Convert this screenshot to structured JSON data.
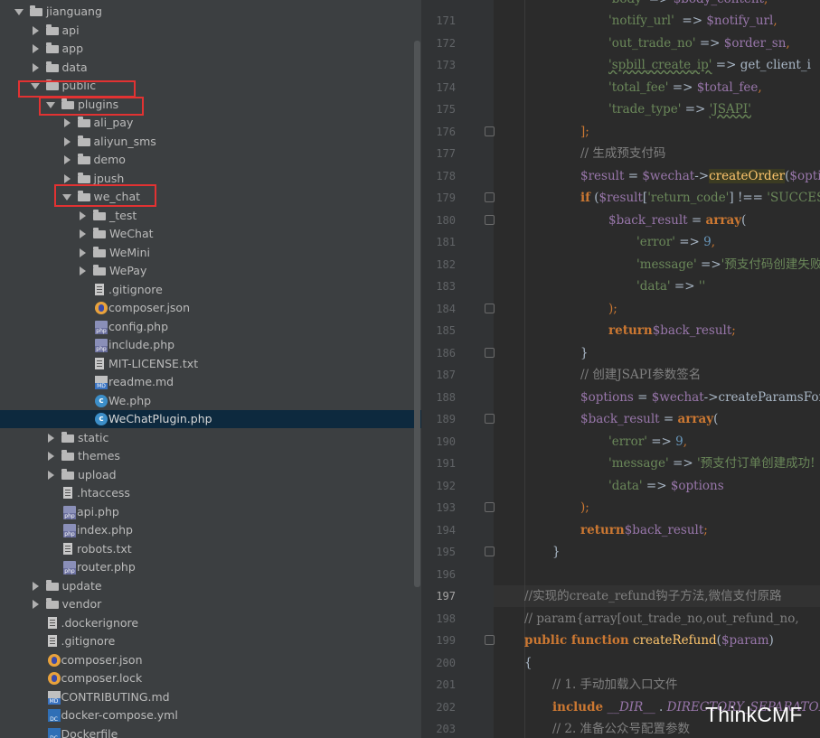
{
  "tree": {
    "rows": [
      {
        "label": "jianguang",
        "type": "folder",
        "expanded": true
      },
      {
        "label": "api",
        "type": "folder",
        "expanded": false
      },
      {
        "label": "app",
        "type": "folder",
        "expanded": false
      },
      {
        "label": "data",
        "type": "folder",
        "expanded": false
      },
      {
        "label": "public",
        "type": "folder",
        "expanded": true
      },
      {
        "label": "plugins",
        "type": "folder",
        "expanded": true
      },
      {
        "label": "ali_pay",
        "type": "folder",
        "expanded": false
      },
      {
        "label": "aliyun_sms",
        "type": "folder",
        "expanded": false
      },
      {
        "label": "demo",
        "type": "folder",
        "expanded": false
      },
      {
        "label": "jpush",
        "type": "folder",
        "expanded": false
      },
      {
        "label": "we_chat",
        "type": "folder",
        "expanded": true
      },
      {
        "label": "_test",
        "type": "folder",
        "expanded": false
      },
      {
        "label": "WeChat",
        "type": "folder",
        "expanded": false
      },
      {
        "label": "WeMini",
        "type": "folder",
        "expanded": false
      },
      {
        "label": "WePay",
        "type": "folder",
        "expanded": false
      },
      {
        "label": ".gitignore",
        "type": "file"
      },
      {
        "label": "composer.json",
        "type": "json"
      },
      {
        "label": "config.php",
        "type": "php"
      },
      {
        "label": "include.php",
        "type": "php"
      },
      {
        "label": "MIT-LICENSE.txt",
        "type": "file"
      },
      {
        "label": "readme.md",
        "type": "md"
      },
      {
        "label": "We.php",
        "type": "class"
      },
      {
        "label": "WeChatPlugin.php",
        "type": "class",
        "selected": true
      },
      {
        "label": "static",
        "type": "folder",
        "expanded": false
      },
      {
        "label": "themes",
        "type": "folder",
        "expanded": false
      },
      {
        "label": "upload",
        "type": "folder",
        "expanded": false
      },
      {
        "label": ".htaccess",
        "type": "file"
      },
      {
        "label": "api.php",
        "type": "php"
      },
      {
        "label": "index.php",
        "type": "php"
      },
      {
        "label": "robots.txt",
        "type": "file"
      },
      {
        "label": "router.php",
        "type": "php"
      },
      {
        "label": "update",
        "type": "folder",
        "expanded": false
      },
      {
        "label": "vendor",
        "type": "folder",
        "expanded": false
      },
      {
        "label": ".dockerignore",
        "type": "file"
      },
      {
        "label": ".gitignore",
        "type": "file"
      },
      {
        "label": "composer.json",
        "type": "json"
      },
      {
        "label": "composer.lock",
        "type": "json"
      },
      {
        "label": "CONTRIBUTING.md",
        "type": "md"
      },
      {
        "label": "docker-compose.yml",
        "type": "yml"
      },
      {
        "label": "Dockerfile",
        "type": "yml"
      }
    ]
  },
  "editor": {
    "current_line": "197",
    "lines": [
      {
        "num": "171",
        "code": [
          [
            "s",
            "'notify_url'"
          ],
          [
            "",
            "  => "
          ],
          [
            "v",
            "$notify_url"
          ],
          [
            "p",
            ","
          ]
        ]
      },
      {
        "num": "172",
        "code": [
          [
            "s",
            "'out_trade_no'"
          ],
          [
            "",
            " => "
          ],
          [
            "v",
            "$order_sn"
          ],
          [
            "p",
            ","
          ]
        ]
      },
      {
        "num": "173",
        "code": [
          [
            "s",
            "'spbill_create_ip'"
          ],
          [
            "",
            " => get_client_i"
          ]
        ]
      },
      {
        "num": "174",
        "code": [
          [
            "s",
            "'total_fee'"
          ],
          [
            "",
            " => "
          ],
          [
            "v",
            "$total_fee"
          ],
          [
            "p",
            ","
          ]
        ]
      },
      {
        "num": "175",
        "code": [
          [
            "s",
            "'trade_type'"
          ],
          [
            "",
            " => "
          ],
          [
            "s",
            "'JSAPI'"
          ]
        ]
      },
      {
        "num": "176",
        "code": [
          [
            "p",
            "];"
          ]
        ]
      },
      {
        "num": "177",
        "code": [
          [
            "c",
            "// 生成预支付码"
          ]
        ]
      },
      {
        "num": "178",
        "code": [
          [
            "v",
            "$result"
          ],
          [
            "",
            " = "
          ],
          [
            "v",
            "$wechat"
          ],
          [
            "",
            "->"
          ],
          [
            "hl",
            "createOrder"
          ],
          [
            "",
            "("
          ],
          [
            "v",
            "$option"
          ]
        ]
      },
      {
        "num": "179",
        "code": [
          [
            "k",
            "if"
          ],
          [
            "",
            " ("
          ],
          [
            "v",
            "$result"
          ],
          [
            "",
            "["
          ],
          [
            "s",
            "'return_code'"
          ],
          [
            "",
            "] !== "
          ],
          [
            "s",
            "'SUCCES"
          ]
        ]
      },
      {
        "num": "180",
        "code": [
          [
            "v",
            "$back_result"
          ],
          [
            "",
            " = "
          ],
          [
            "k",
            "array"
          ],
          [
            "",
            "("
          ]
        ]
      },
      {
        "num": "181",
        "code": [
          [
            "s",
            "'error'"
          ],
          [
            "",
            " => "
          ],
          [
            "n",
            "9"
          ],
          [
            "p",
            ","
          ]
        ]
      },
      {
        "num": "182",
        "code": [
          [
            "s",
            "'message'"
          ],
          [
            "",
            " =>"
          ],
          [
            "s",
            "'预支付码创建失败"
          ]
        ]
      },
      {
        "num": "183",
        "code": [
          [
            "s",
            "'data'"
          ],
          [
            "",
            " => "
          ],
          [
            "s",
            "''"
          ]
        ]
      },
      {
        "num": "184",
        "code": [
          [
            "p",
            ");"
          ]
        ]
      },
      {
        "num": "185",
        "code": [
          [
            "k",
            "return"
          ],
          [
            " ",
            ""
          ],
          [
            "v",
            "$back_result"
          ],
          [
            "p",
            ";"
          ]
        ]
      },
      {
        "num": "186",
        "code": [
          [
            "",
            "}"
          ]
        ]
      },
      {
        "num": "187",
        "code": [
          [
            "c",
            "// 创建JSAPI参数签名"
          ]
        ]
      },
      {
        "num": "188",
        "code": [
          [
            "v",
            "$options"
          ],
          [
            "",
            " = "
          ],
          [
            "v",
            "$wechat"
          ],
          [
            "",
            "->createParamsForJsA"
          ]
        ]
      },
      {
        "num": "189",
        "code": [
          [
            "v",
            "$back_result"
          ],
          [
            "",
            " = "
          ],
          [
            "k",
            "array"
          ],
          [
            "",
            "("
          ]
        ]
      },
      {
        "num": "190",
        "code": [
          [
            "s",
            "'error'"
          ],
          [
            "",
            " => "
          ],
          [
            "n",
            "9"
          ],
          [
            "p",
            ","
          ]
        ]
      },
      {
        "num": "191",
        "code": [
          [
            "s",
            "'message'"
          ],
          [
            "",
            " => "
          ],
          [
            "s",
            "'预支付订单创建成功!"
          ]
        ]
      },
      {
        "num": "192",
        "code": [
          [
            "s",
            "'data'"
          ],
          [
            "",
            " => "
          ],
          [
            "v",
            "$options"
          ]
        ]
      },
      {
        "num": "193",
        "code": [
          [
            "p",
            ");"
          ]
        ]
      },
      {
        "num": "194",
        "code": [
          [
            "k",
            "return"
          ],
          [
            " ",
            ""
          ],
          [
            "v",
            "$back_result"
          ],
          [
            "p",
            ";"
          ]
        ]
      },
      {
        "num": "195",
        "code": [
          [
            "",
            "}"
          ]
        ]
      },
      {
        "num": "196",
        "code": []
      },
      {
        "num": "197",
        "code": [
          [
            "c",
            "//实现的create_refund钩子方法,微信支付原路"
          ]
        ]
      },
      {
        "num": "198",
        "code": [
          [
            "c",
            "// param{array[out_trade_no,out_refund_no,"
          ]
        ]
      },
      {
        "num": "199",
        "code": [
          [
            "k",
            "public function"
          ],
          [
            "",
            " "
          ],
          [
            "f",
            "createRefund"
          ],
          [
            "",
            "("
          ],
          [
            "v",
            "$param"
          ],
          [
            "",
            ")"
          ]
        ]
      },
      {
        "num": "200",
        "code": [
          [
            "",
            "{"
          ]
        ]
      },
      {
        "num": "201",
        "code": [
          [
            "c",
            "// 1. 手动加载入口文件"
          ]
        ]
      },
      {
        "num": "202",
        "code": [
          [
            "k",
            "include"
          ],
          [
            "",
            " "
          ],
          [
            "ci",
            "__DIR__"
          ],
          [
            "",
            " . "
          ],
          [
            "ci",
            "DIRECTORY_SEPARATOR"
          ]
        ]
      },
      {
        "num": "203",
        "code": [
          [
            "c",
            "// 2. 准备公众号配置参数"
          ]
        ]
      }
    ],
    "top_partial": [
      [
        "s",
        "'body'"
      ],
      [
        "",
        " => "
      ],
      [
        "v",
        "$body_content"
      ],
      [
        "p",
        ","
      ]
    ]
  },
  "watermark": "ThinkCMF"
}
